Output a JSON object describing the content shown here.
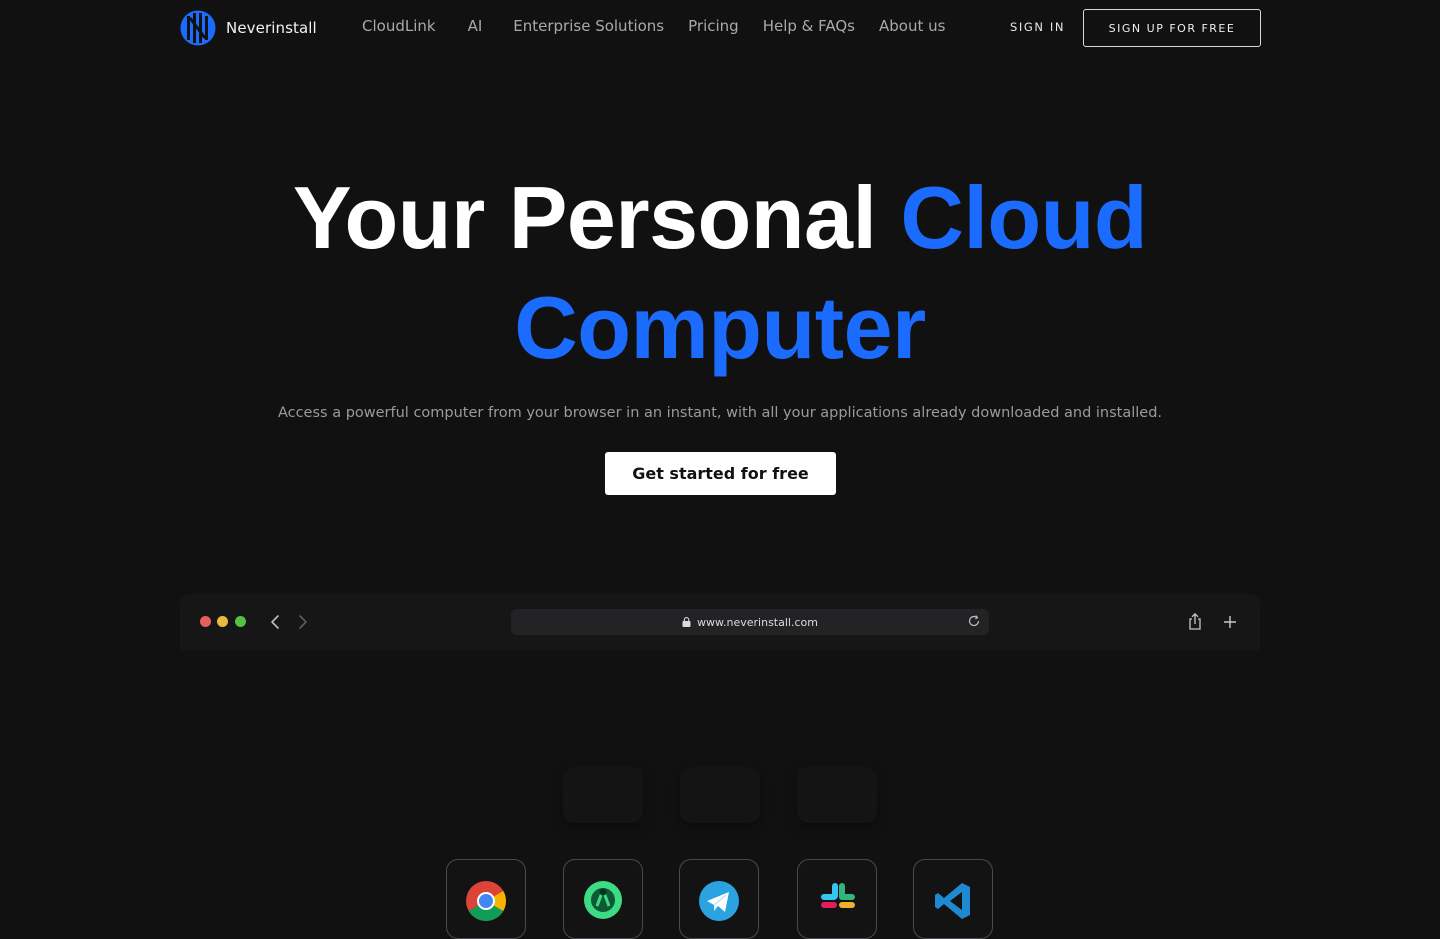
{
  "header": {
    "brand": "Neverinstall",
    "nav": [
      "CloudLink",
      "AI",
      "Enterprise Solutions",
      "Pricing",
      "Help & FAQs",
      "About us"
    ],
    "sign_in": "SIGN IN",
    "sign_up": "SIGN UP FOR FREE"
  },
  "hero": {
    "title_white": "Your Personal ",
    "title_blue_1": "Cloud",
    "title_blue_2": "Computer",
    "subtitle": "Access a powerful computer from your browser in an instant, with all your applications already downloaded and installed.",
    "cta": "Get started for free"
  },
  "browser": {
    "url": "www.neverinstall.com"
  },
  "apps": [
    "chrome-icon",
    "android-studio-icon",
    "telegram-icon",
    "slack-icon",
    "vscode-icon"
  ],
  "colors": {
    "background": "#111112",
    "accent_blue": "#1c6bff",
    "nav_text": "#a9a9ad",
    "cta_bg": "#ffffff"
  }
}
